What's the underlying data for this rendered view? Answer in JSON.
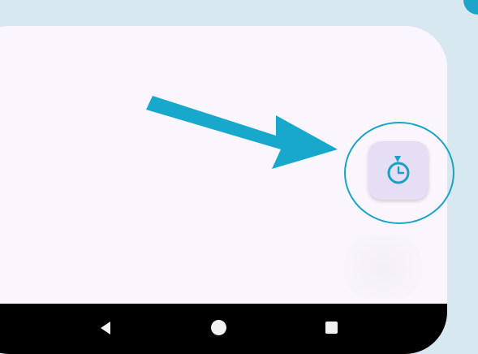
{
  "screen": {
    "background_color": "#fbf6fd",
    "page_background": "#d7e8f1",
    "accent_color": "#1ca5c8"
  },
  "tutorial": {
    "arrow_icon": "arrow-right-icon",
    "highlight_ring": "focus-ring"
  },
  "floating_button": {
    "icon": "timer-icon",
    "background_color": "#e6def5",
    "icon_color": "#19a2c5"
  },
  "navigation_bar": {
    "back_icon": "back-icon",
    "home_icon": "home-icon",
    "recents_icon": "recents-icon"
  }
}
